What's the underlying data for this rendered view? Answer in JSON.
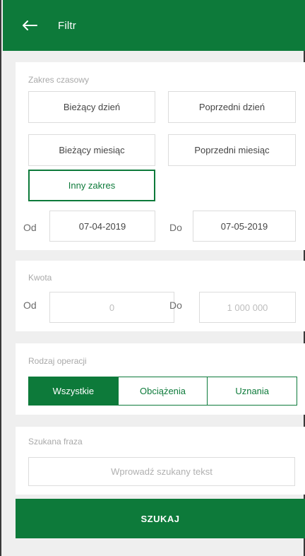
{
  "header": {
    "title": "Filtr",
    "back_icon": "arrow-left-icon"
  },
  "date_range": {
    "label": "Zakres czasowy",
    "options": [
      "Bieżący dzień",
      "Poprzedni dzień",
      "Bieżący miesiąc",
      "Poprzedni miesiąc",
      "Inny zakres"
    ],
    "selected": "Inny zakres",
    "from_label": "Od",
    "from_value": "07-04-2019",
    "to_label": "Do",
    "to_value": "07-05-2019"
  },
  "amount": {
    "label": "Kwota",
    "from_label": "Od",
    "from_value": "0",
    "to_label": "Do",
    "to_value": "1 000 000"
  },
  "operation_type": {
    "label": "Rodzaj operacji",
    "options": [
      "Wszystkie",
      "Obciążenia",
      "Uznania"
    ],
    "selected": "Wszystkie"
  },
  "search": {
    "label": "Szukana fraza",
    "placeholder": "Wprowadź szukany tekst",
    "value": ""
  },
  "submit_label": "SZUKAJ",
  "colors": {
    "primary": "#0d7a3a",
    "background": "#efefef",
    "card": "#ffffff",
    "muted_text": "#a9a9a9"
  }
}
